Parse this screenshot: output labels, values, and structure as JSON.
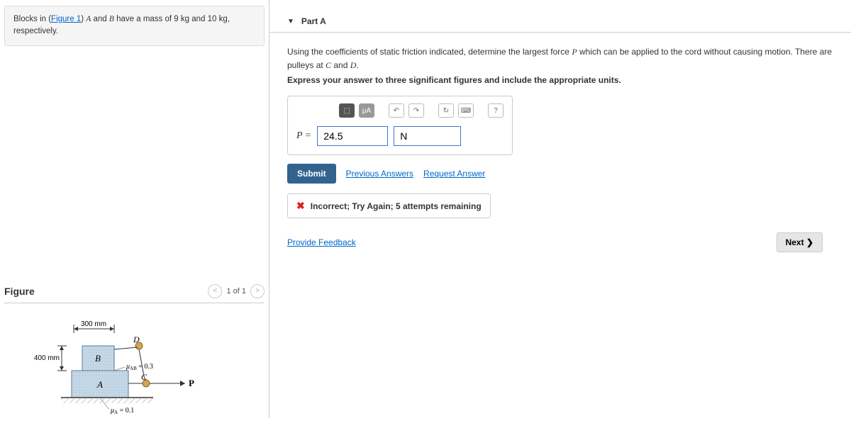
{
  "problem": {
    "prefix": "Blocks in (",
    "figure_link": "Figure 1",
    "suffix_1": ") ",
    "var_a": "A",
    "and1": " and ",
    "var_b": "B",
    "text_rest": " have a mass of 9 kg and 10 kg, respectively."
  },
  "figure": {
    "title": "Figure",
    "nav": "1 of 1",
    "dim_top": "300 mm",
    "dim_left": "400 mm",
    "label_a": "A",
    "label_b": "B",
    "label_c": "C",
    "label_d": "D",
    "label_p": "P",
    "mu_ab": "μ_AB = 0.3",
    "mu_a": "μ_A = 0.1"
  },
  "part": {
    "header": "Part A",
    "instr_1a": "Using the coefficients of static friction indicated, determine the largest force ",
    "instr_1_p": "P",
    "instr_1b": " which can be applied to the cord without causing motion. There are pulleys at ",
    "instr_1_c": "C",
    "instr_1c": " and ",
    "instr_1_d": "D",
    "instr_1d": ".",
    "instr_2": "Express your answer to three significant figures and include the appropriate units.",
    "toolbar": {
      "templates": "⬚",
      "mu_a": "μA",
      "undo": "↶",
      "redo": "↷",
      "reset": "↻",
      "keyboard": "⌨",
      "help": "?"
    },
    "var_label": "P =",
    "value": "24.5",
    "unit": "N",
    "submit": "Submit",
    "prev_ans": "Previous Answers",
    "req_ans": "Request Answer",
    "feedback": "Incorrect; Try Again; 5 attempts remaining",
    "provide_fb": "Provide Feedback",
    "next": "Next ❯"
  }
}
